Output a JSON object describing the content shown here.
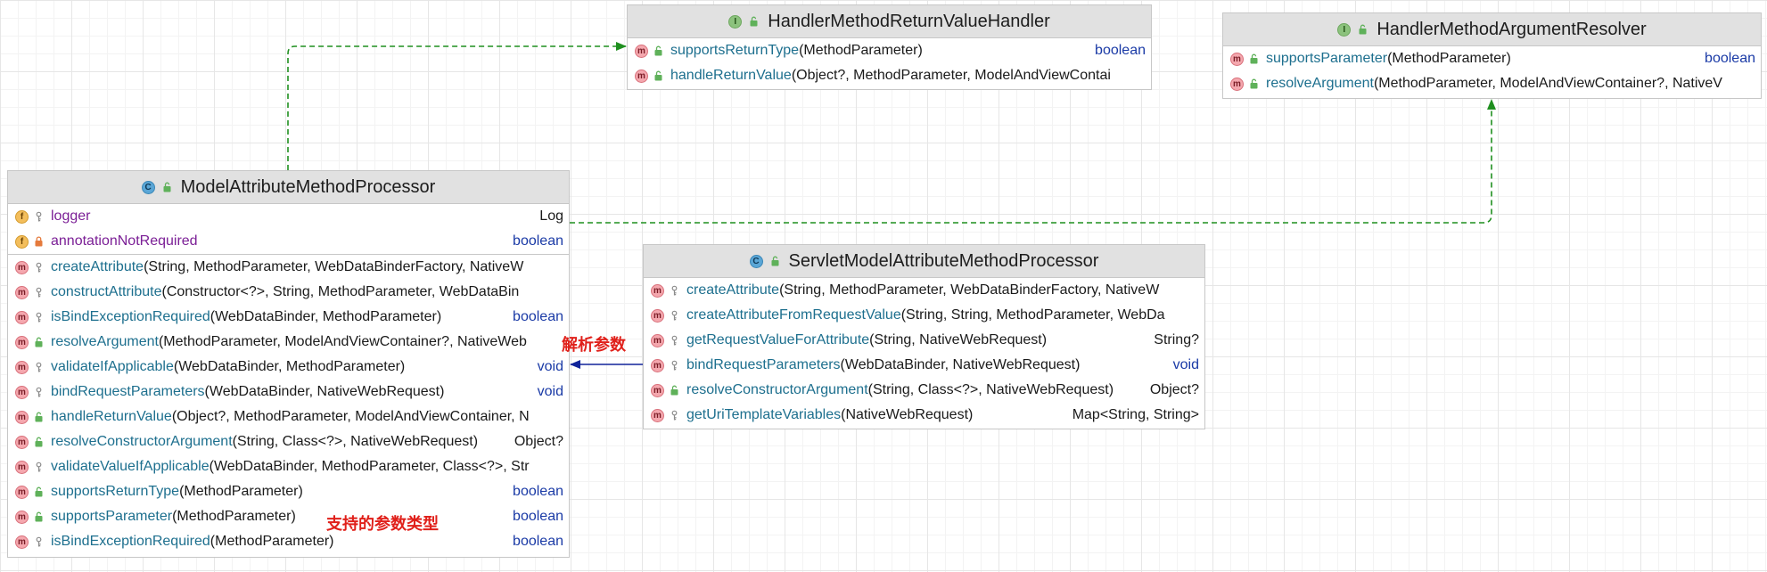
{
  "annotations": {
    "resolve_args": "解析参数",
    "supported_param_types": "支持的参数类型"
  },
  "classes": {
    "model_attribute_method_processor": {
      "kind": "class",
      "title": "ModelAttributeMethodProcessor",
      "fields": [
        {
          "name": "logger",
          "type": "Log"
        },
        {
          "name": "annotationNotRequired",
          "type": "boolean"
        }
      ],
      "methods": [
        {
          "name": "createAttribute",
          "params": "(String, MethodParameter, WebDataBinderFactory, NativeW",
          "ret": ""
        },
        {
          "name": "constructAttribute",
          "params": "(Constructor<?>, String, MethodParameter, WebDataBin",
          "ret": ""
        },
        {
          "name": "isBindExceptionRequired",
          "params": "(WebDataBinder, MethodParameter)",
          "ret": "boolean"
        },
        {
          "name": "resolveArgument",
          "params": "(MethodParameter, ModelAndViewContainer?, NativeWeb",
          "ret": ""
        },
        {
          "name": "validateIfApplicable",
          "params": "(WebDataBinder, MethodParameter)",
          "ret": "void"
        },
        {
          "name": "bindRequestParameters",
          "params": "(WebDataBinder, NativeWebRequest)",
          "ret": "void"
        },
        {
          "name": "handleReturnValue",
          "params": "(Object?, MethodParameter, ModelAndViewContainer, N",
          "ret": ""
        },
        {
          "name": "resolveConstructorArgument",
          "params": "(String, Class<?>, NativeWebRequest)",
          "ret": "Object?"
        },
        {
          "name": "validateValueIfApplicable",
          "params": "(WebDataBinder, MethodParameter, Class<?>, Str",
          "ret": ""
        },
        {
          "name": "supportsReturnType",
          "params": "(MethodParameter)",
          "ret": "boolean"
        },
        {
          "name": "supportsParameter",
          "params": "(MethodParameter)",
          "ret": "boolean"
        },
        {
          "name": "isBindExceptionRequired",
          "params": "(MethodParameter)",
          "ret": "boolean"
        }
      ]
    },
    "handler_method_return_value_handler": {
      "kind": "interface",
      "title": "HandlerMethodReturnValueHandler",
      "methods": [
        {
          "name": "supportsReturnType",
          "params": "(MethodParameter)",
          "ret": "boolean"
        },
        {
          "name": "handleReturnValue",
          "params": "(Object?, MethodParameter, ModelAndViewContai",
          "ret": ""
        }
      ]
    },
    "handler_method_argument_resolver": {
      "kind": "interface",
      "title": "HandlerMethodArgumentResolver",
      "methods": [
        {
          "name": "supportsParameter",
          "params": "(MethodParameter)",
          "ret": "boolean"
        },
        {
          "name": "resolveArgument",
          "params": "(MethodParameter, ModelAndViewContainer?, NativeV",
          "ret": ""
        }
      ]
    },
    "servlet_model_attribute_method_processor": {
      "kind": "class",
      "title": "ServletModelAttributeMethodProcessor",
      "methods": [
        {
          "name": "createAttribute",
          "params": "(String, MethodParameter, WebDataBinderFactory, NativeW",
          "ret": ""
        },
        {
          "name": "createAttributeFromRequestValue",
          "params": "(String, String, MethodParameter, WebDa",
          "ret": ""
        },
        {
          "name": "getRequestValueForAttribute",
          "params": "(String, NativeWebRequest)",
          "ret": "String?"
        },
        {
          "name": "bindRequestParameters",
          "params": "(WebDataBinder, NativeWebRequest)",
          "ret": "void"
        },
        {
          "name": "resolveConstructorArgument",
          "params": "(String, Class<?>, NativeWebRequest)",
          "ret": "Object?"
        },
        {
          "name": "getUriTemplateVariables",
          "params": "(NativeWebRequest)",
          "ret": "Map<String, String>"
        }
      ]
    }
  }
}
